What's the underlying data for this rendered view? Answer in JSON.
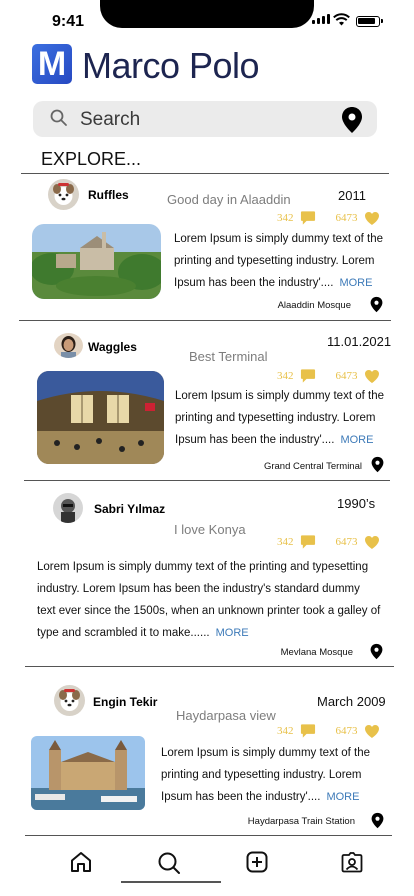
{
  "status": {
    "time": "9:41"
  },
  "app": {
    "logo_letter": "M",
    "title": "Marco Polo",
    "logo_color": "#2f5bd6"
  },
  "search": {
    "placeholder": "Search"
  },
  "section": {
    "title": "EXPLORE..."
  },
  "accent": "#e8c14a",
  "link_color": "#3d7ab8",
  "posts": [
    {
      "user": "Ruffles",
      "caption": "Good day in Alaaddin",
      "date": "2011",
      "comments": "342",
      "likes": "6473",
      "text_lines": [
        "Lorem Ipsum is simply dummy text of the",
        "printing and typesetting industry. Lorem",
        "Ipsum has been the industry'...."
      ],
      "more": "MORE",
      "location": "Alaaddin Mosque"
    },
    {
      "user": "Waggles",
      "caption": "Best Terminal",
      "date": "11.01.2021",
      "comments": "342",
      "likes": "6473",
      "text_lines": [
        "Lorem Ipsum is simply dummy text of the",
        "printing and typesetting industry. Lorem",
        "Ipsum has been the industry'...."
      ],
      "more": "MORE",
      "location": "Grand Central Terminal"
    },
    {
      "user": "Sabri Yılmaz",
      "caption": "I love Konya",
      "date": "1990’s",
      "comments": "342",
      "likes": "6473",
      "text_lines": [
        "Lorem Ipsum is simply dummy text of the printing and typesetting",
        "industry. Lorem Ipsum has been the industry's standard dummy",
        "text ever since the 1500s, when an unknown printer took a galley of",
        "type and scrambled it to make......"
      ],
      "more": "MORE",
      "location": "Mevlana Mosque"
    },
    {
      "user": "Engin Tekir",
      "caption": "Haydarpasa view",
      "date": "March 2009",
      "comments": "342",
      "likes": "6473",
      "text_lines": [
        "Lorem Ipsum is simply dummy text of the",
        "printing and typesetting industry. Lorem",
        "Ipsum has been the industry'...."
      ],
      "more": "MORE",
      "location": "Haydarpasa Train Station"
    }
  ],
  "tabs": [
    {
      "icon": "home-icon"
    },
    {
      "icon": "search-icon"
    },
    {
      "icon": "add-icon"
    },
    {
      "icon": "profile-icon"
    }
  ]
}
